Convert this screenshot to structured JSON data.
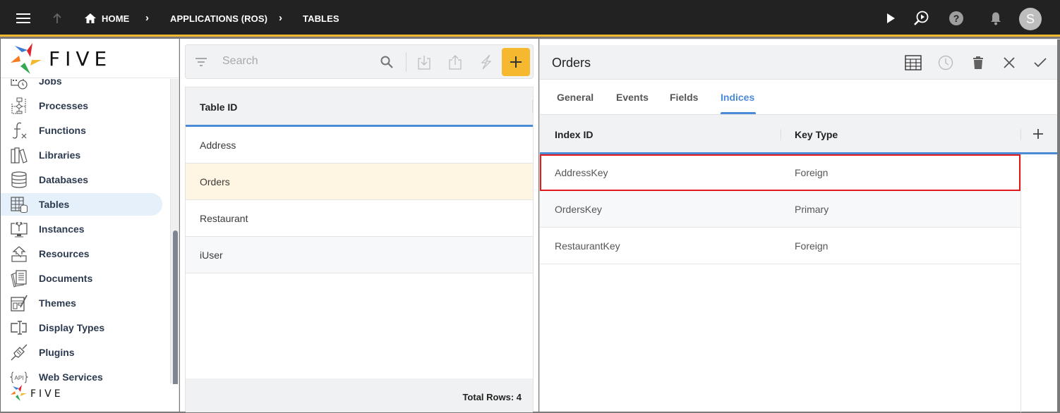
{
  "topbar": {
    "breadcrumbs": [
      "HOME",
      "APPLICATIONS (ROS)",
      "TABLES"
    ],
    "icons": [
      "menu-icon",
      "up-arrow-icon",
      "home-icon",
      "play-icon",
      "search-play-icon",
      "help-icon",
      "bell-icon"
    ],
    "avatar_initial": "S"
  },
  "brand": {
    "name": "FIVE"
  },
  "sidebar": {
    "items": [
      {
        "label": "Jobs",
        "icon": "jobs-icon"
      },
      {
        "label": "Processes",
        "icon": "processes-icon"
      },
      {
        "label": "Functions",
        "icon": "functions-icon"
      },
      {
        "label": "Libraries",
        "icon": "libraries-icon"
      },
      {
        "label": "Databases",
        "icon": "databases-icon"
      },
      {
        "label": "Tables",
        "icon": "tables-icon",
        "active": true
      },
      {
        "label": "Instances",
        "icon": "instances-icon"
      },
      {
        "label": "Resources",
        "icon": "resources-icon"
      },
      {
        "label": "Documents",
        "icon": "documents-icon"
      },
      {
        "label": "Themes",
        "icon": "themes-icon"
      },
      {
        "label": "Display Types",
        "icon": "display-types-icon"
      },
      {
        "label": "Plugins",
        "icon": "plugins-icon"
      },
      {
        "label": "Web Services",
        "icon": "web-services-icon"
      }
    ]
  },
  "list": {
    "search_placeholder": "Search",
    "column_header": "Table ID",
    "rows": [
      "Address",
      "Orders",
      "Restaurant",
      "iUser"
    ],
    "selected_row": "Orders",
    "total_rows_label": "Total Rows: 4"
  },
  "form": {
    "title": "Orders",
    "tabs": [
      "General",
      "Events",
      "Fields",
      "Indices"
    ],
    "active_tab": "Indices",
    "grid": {
      "headers": [
        "Index ID",
        "Key Type"
      ],
      "rows": [
        {
          "index_id": "AddressKey",
          "key_type": "Foreign",
          "highlighted": true
        },
        {
          "index_id": "OrdersKey",
          "key_type": "Primary"
        },
        {
          "index_id": "RestaurantKey",
          "key_type": "Foreign"
        }
      ]
    }
  },
  "colors": {
    "accent": "#4a8ad6",
    "brand_yellow": "#f5b82e",
    "topbar": "#222222",
    "highlight_border": "#e21a1a",
    "selected_row": "#fff5e3"
  }
}
